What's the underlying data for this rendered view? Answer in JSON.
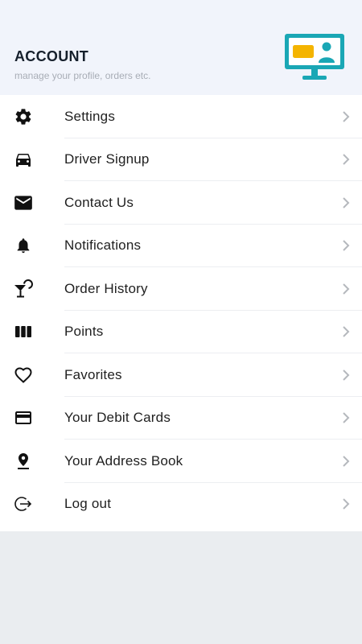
{
  "header": {
    "title": "ACCOUNT",
    "subtitle": "manage your profile, orders etc.",
    "illustration": "monitor-profile-icon"
  },
  "menu": {
    "items": [
      {
        "label": "Settings",
        "icon": "gear-icon"
      },
      {
        "label": "Driver Signup",
        "icon": "car-icon"
      },
      {
        "label": "Contact Us",
        "icon": "mail-icon"
      },
      {
        "label": "Notifications",
        "icon": "bell-icon"
      },
      {
        "label": "Order History",
        "icon": "cocktail-icon"
      },
      {
        "label": "Points",
        "icon": "bars-icon"
      },
      {
        "label": "Favorites",
        "icon": "heart-icon"
      },
      {
        "label": "Your Debit Cards",
        "icon": "card-icon"
      },
      {
        "label": "Your Address Book",
        "icon": "location-pin-icon"
      },
      {
        "label": "Log out",
        "icon": "logout-icon"
      }
    ]
  },
  "colors": {
    "header_bg": "#f1f4fb",
    "monitor": "#1aa7b5",
    "card_accent": "#f4b400",
    "chevron": "#b5b8bd"
  }
}
